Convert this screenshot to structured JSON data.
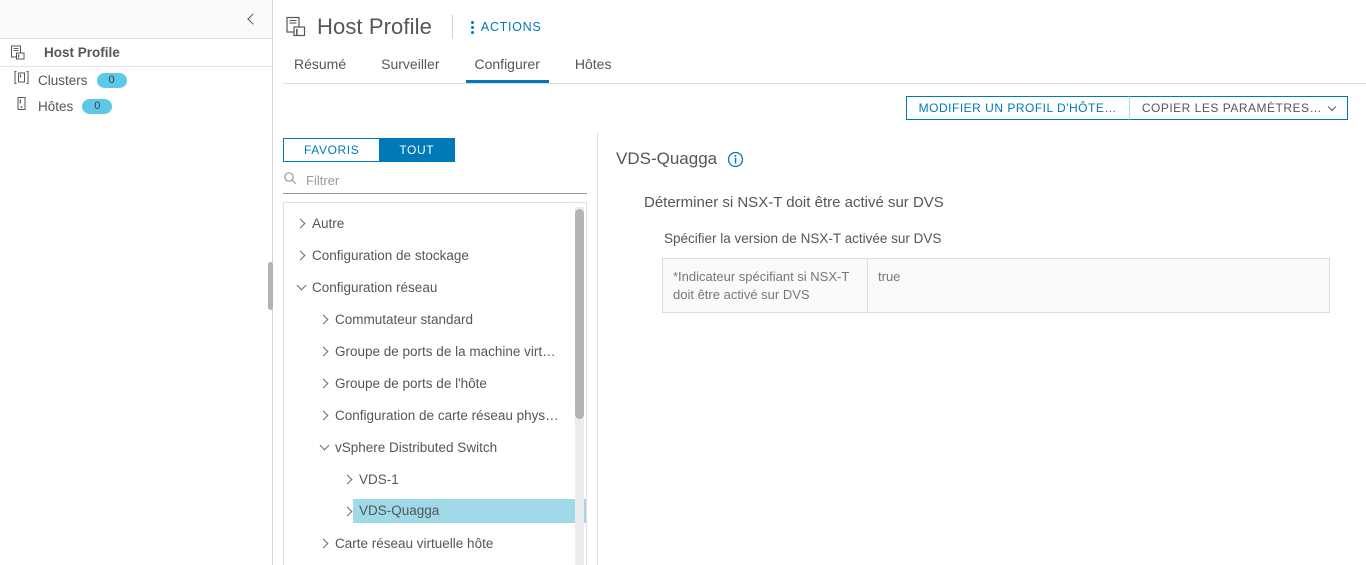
{
  "left_nav": {
    "collapse_icon": "chevron-left-icon",
    "profile": {
      "icon": "host-profile-icon",
      "label": "Host Profile"
    },
    "items": [
      {
        "icon": "cluster-icon",
        "label": "Clusters",
        "badge": "0",
        "badge_color": "#5ec8e8"
      },
      {
        "icon": "host-icon",
        "label": "Hôtes",
        "badge": "0",
        "badge_color": "#5ec8e8"
      }
    ]
  },
  "header": {
    "icon": "host-profile-icon",
    "title": "Host Profile",
    "actions": {
      "icon": "kebab-menu-icon",
      "label": "ACTIONS"
    },
    "tabs": [
      {
        "label": "Résumé",
        "active": false
      },
      {
        "label": "Surveiller",
        "active": false
      },
      {
        "label": "Configurer",
        "active": true
      },
      {
        "label": "Hôtes",
        "active": false
      }
    ]
  },
  "toolbar": {
    "edit_button": "MODIFIER UN PROFIL D'HÔTE…",
    "copy_button": "COPIER LES PARAMÈTRES…",
    "copy_caret_icon": "chevron-down-icon"
  },
  "tree_panel": {
    "toggle": {
      "favoris": "FAVORIS",
      "tout": "TOUT",
      "selected": "TOUT"
    },
    "filter": {
      "icon": "search-icon",
      "value": "",
      "placeholder": "Filtrer"
    },
    "nodes": [
      {
        "label": "Autre",
        "level": 0,
        "state": "closed",
        "selected": false
      },
      {
        "label": "Configuration de stockage",
        "level": 0,
        "state": "closed",
        "selected": false
      },
      {
        "label": "Configuration réseau",
        "level": 0,
        "state": "open",
        "selected": false
      },
      {
        "label": "Commutateur standard",
        "level": 1,
        "state": "closed",
        "selected": false
      },
      {
        "label": "Groupe de ports de la machine virt…",
        "level": 1,
        "state": "closed",
        "selected": false
      },
      {
        "label": "Groupe de ports de l'hôte",
        "level": 1,
        "state": "closed",
        "selected": false
      },
      {
        "label": "Configuration de carte réseau phys…",
        "level": 1,
        "state": "closed",
        "selected": false
      },
      {
        "label": "vSphere Distributed Switch",
        "level": 1,
        "state": "open",
        "selected": false
      },
      {
        "label": "VDS-1",
        "level": 2,
        "state": "closed",
        "selected": false
      },
      {
        "label": "VDS-Quagga",
        "level": 2,
        "state": "closed",
        "selected": true
      },
      {
        "label": "Carte réseau virtuelle hôte",
        "level": 1,
        "state": "closed",
        "selected": false
      }
    ],
    "selection_color": "#9fd9e8"
  },
  "detail": {
    "title": "VDS-Quagga",
    "info_icon": "info-circle-icon",
    "section_heading": "Déterminer si NSX-T doit être activé sur DVS",
    "sub_heading": "Spécifier la version de NSX-T activée sur DVS",
    "property_table": {
      "rows": [
        {
          "key": "*Indicateur spécifiant si NSX-T doit être activé sur DVS",
          "value": "true"
        }
      ]
    }
  },
  "colors": {
    "accent": "#0079b8",
    "badge": "#5ec8e8",
    "selection": "#9fd9e8",
    "text": "#565656"
  }
}
